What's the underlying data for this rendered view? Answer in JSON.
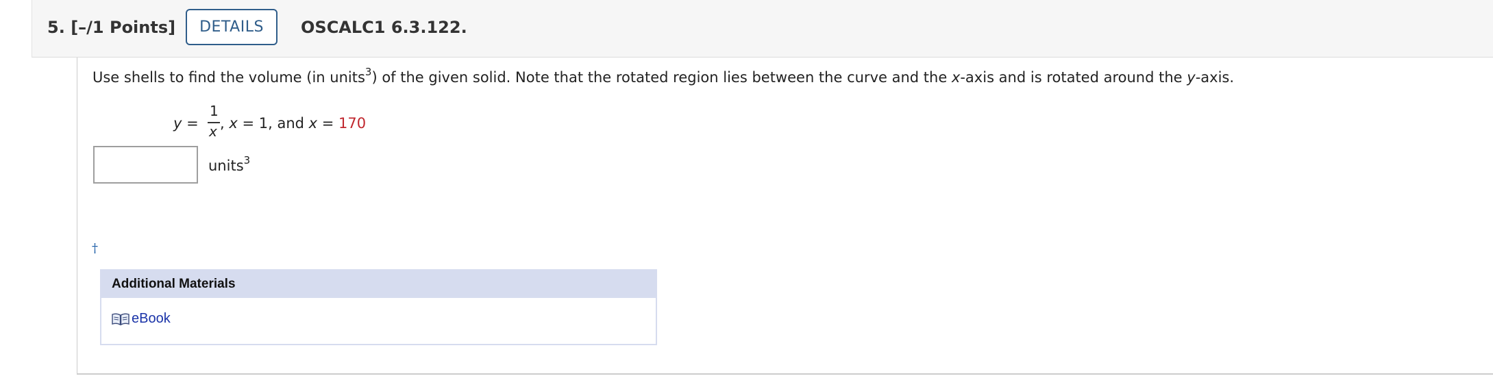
{
  "header": {
    "question_number": "5.",
    "points": "[–/1 Points]",
    "details_label": "DETAILS",
    "assignment_code": "OSCALC1 6.3.122."
  },
  "question": {
    "prompt_part1": "Use shells to find the volume (in units",
    "prompt_sup": "3",
    "prompt_part2": ") of the given solid. Note that the rotated region lies between the curve and the ",
    "prompt_x": "x",
    "prompt_part3": "-axis and is rotated around the ",
    "prompt_y": "y",
    "prompt_part4": "-axis.",
    "eq_y": "y",
    "eq_equals": " =",
    "eq_frac_num": "1",
    "eq_frac_den": "x",
    "eq_comma": ",",
    "eq_x1": "x",
    "eq_x1_rest": " = 1, and ",
    "eq_x2": "x",
    "eq_x2_equals": " = ",
    "eq_x2_value": "170"
  },
  "answer": {
    "value": "",
    "units_label": "units",
    "units_sup": "3"
  },
  "footnote_marker": "†",
  "additional_materials": {
    "title": "Additional Materials",
    "links": [
      {
        "label": "eBook",
        "icon": "book-icon"
      }
    ]
  },
  "colors": {
    "details_border": "#2f5d8a",
    "highlight_value": "#c0262d",
    "materials_header_bg": "#d6dcef",
    "link": "#1a33a8"
  }
}
